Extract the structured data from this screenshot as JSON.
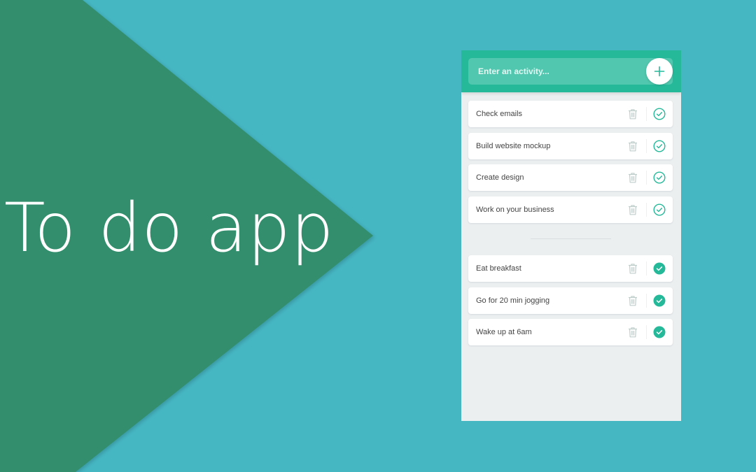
{
  "hero": {
    "title": "To do app"
  },
  "input": {
    "placeholder": "Enter an activity..."
  },
  "icons": {
    "add": "plus-icon",
    "delete": "trash-icon",
    "complete_outline": "check-circle-outline-icon",
    "complete_filled": "check-circle-filled-icon"
  },
  "colors": {
    "background": "#45b7c3",
    "banner": "#318e6d",
    "accent": "#25b99a",
    "panel": "#eceff0",
    "trash": "#c0cecb"
  },
  "todo": {
    "items": [
      {
        "text": "Check emails"
      },
      {
        "text": "Build website mockup"
      },
      {
        "text": "Create design"
      },
      {
        "text": "Work on your business"
      }
    ]
  },
  "completed": {
    "items": [
      {
        "text": "Eat breakfast"
      },
      {
        "text": "Go for 20 min jogging"
      },
      {
        "text": "Wake up at 6am"
      }
    ]
  }
}
